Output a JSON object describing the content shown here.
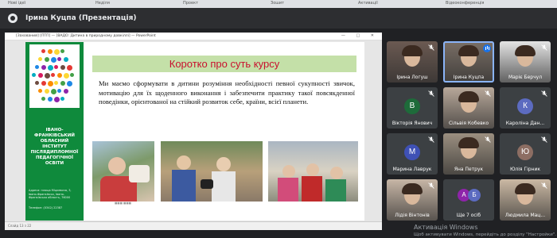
{
  "presenter": {
    "label": "Ірина Куцпа (Презентація)"
  },
  "powerpoint": {
    "window_title": "[Захований] [ПТП] — [ВАДО: Дитина в природному довкіллі] — PowerPoint",
    "window_controls": "— □ ✕",
    "status_text": "Слайд 13 з 22"
  },
  "slide": {
    "title": "Коротко про суть курсу",
    "body": "Ми маємо сформувати в дитини розуміння необхідності певної сукупності звичок, мотивацію для їх щоденного виконання і забезпечити практику такої повсякденної поведінки, орієнтованої на стійкий розвиток себе, країни, всієї планети.",
    "institute": "ІВАНО-ФРАНКІВСЬКИЙ ОБЛАСНИЙ ІНСТИТУТ ПІСЛЯДИПЛОМНОЇ ПЕДАГОГІЧНОЇ ОСВІТИ",
    "address": "Адреса: площа Міцкевича, 3, Івано-Франківськ, Івано-Франківська область, 76000",
    "phone": "Телефон: (0342) 22387",
    "photo_caption": "■■■ ■■■"
  },
  "participants": [
    {
      "name": "Ірина Логуш",
      "type": "video",
      "muted": true,
      "speaking": false,
      "color": "#6b5a52"
    },
    {
      "name": "Ірина Куцпа",
      "type": "video",
      "muted": false,
      "speaking": true,
      "color": "#7a6f66"
    },
    {
      "name": "Маріє Берчул",
      "type": "video",
      "muted": true,
      "speaking": false,
      "color": "#e4e4e4"
    },
    {
      "name": "Вікторія Янович",
      "type": "avatar",
      "initial": "В",
      "muted": true,
      "speaking": false,
      "color": "#1e6b3a"
    },
    {
      "name": "Сільвія Кобевко",
      "type": "video",
      "muted": true,
      "speaking": false,
      "color": "#b8a89a"
    },
    {
      "name": "Кароліна Дан...",
      "type": "avatar",
      "initial": "К",
      "muted": true,
      "speaking": false,
      "color": "#5c6bc0"
    },
    {
      "name": "Марина Лаврук",
      "type": "avatar",
      "initial": "М",
      "muted": true,
      "speaking": false,
      "color": "#3f51b5"
    },
    {
      "name": "Яна Петрук",
      "type": "video",
      "muted": true,
      "speaking": false,
      "color": "#9b8f80"
    },
    {
      "name": "Юлія Гірник",
      "type": "avatar",
      "initial": "Ю",
      "muted": true,
      "speaking": false,
      "color": "#8d6e63"
    },
    {
      "name": "Лідія Вінтонів",
      "type": "video",
      "muted": true,
      "speaking": false,
      "color": "#c7b6a6"
    },
    {
      "name": "Ще 7 осіб",
      "type": "more",
      "initials": [
        "А",
        "Б"
      ],
      "muted": false,
      "speaking": false,
      "color": "#3c4043"
    },
    {
      "name": "Людмила Мац...",
      "type": "video",
      "muted": true,
      "speaking": false,
      "color": "#cbb9a4"
    }
  ],
  "browser_tabs": [
    "Нові ідеї",
    "Неділя",
    "Проект",
    "Зошит",
    "Активації",
    "Відеоконференція"
  ],
  "watermark": {
    "title": "Активація Windows",
    "subtitle": "Щоб активувати Windows, перейдіть до розділу \"Настройки\"."
  }
}
